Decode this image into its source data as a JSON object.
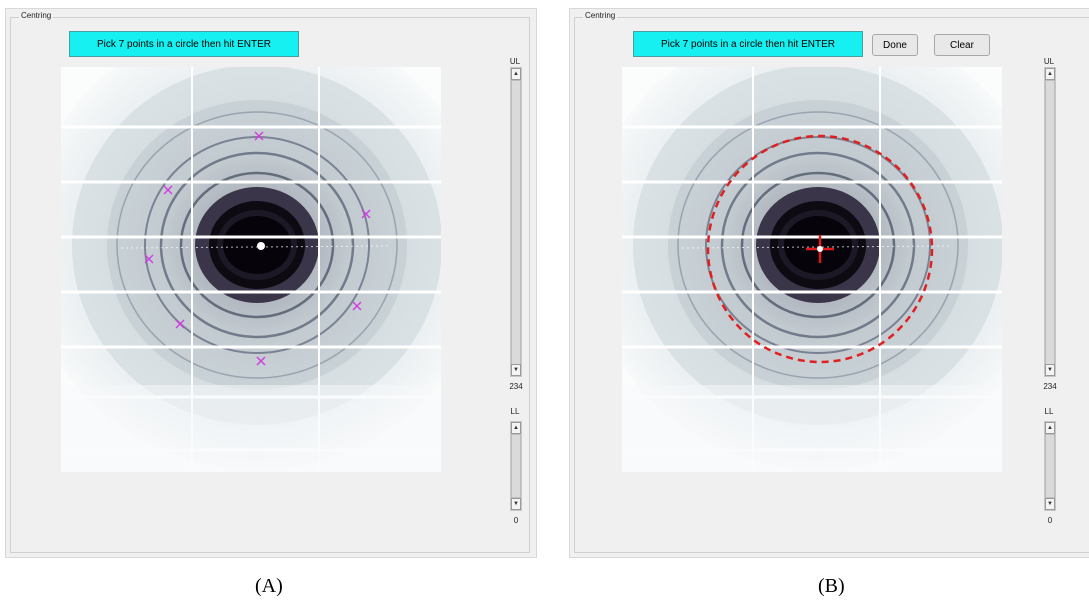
{
  "panels": [
    {
      "id": "A",
      "group_title": "Centring",
      "instruction_button": "Pick 7 points in a circle then hit ENTER",
      "upper_label": "UL",
      "upper_value": "234",
      "lower_label": "LL",
      "lower_value": "0",
      "caption": "(A)"
    },
    {
      "id": "B",
      "group_title": "Centring",
      "instruction_button": "Pick 7 points in a circle then hit ENTER",
      "done_button": "Done",
      "clear_button": "Clear",
      "upper_label": "UL",
      "upper_value": "234",
      "lower_label": "LL",
      "lower_value": "0",
      "caption": "(B)"
    }
  ],
  "picked_points_count": 7,
  "colors": {
    "banner": "#16f0f0",
    "marker": "#d040e0",
    "fit_circle": "#e02020",
    "center_marker": "#e01818"
  },
  "icons": {
    "up_arrow": "▲",
    "down_arrow": "▼"
  }
}
